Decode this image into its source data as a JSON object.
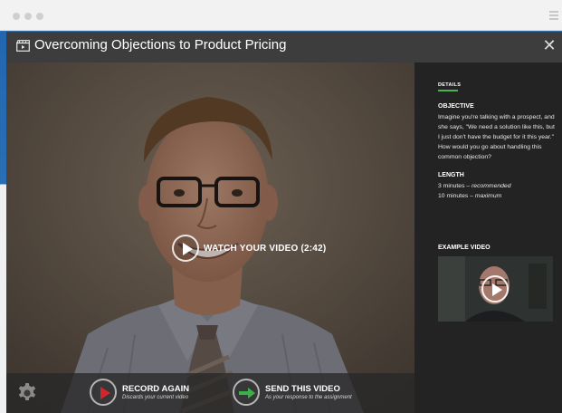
{
  "modal": {
    "title": "Overcoming Objections to Product Pricing"
  },
  "video": {
    "watch_label": "WATCH YOUR VIDEO (2:42)"
  },
  "controls": {
    "record_title": "RECORD AGAIN",
    "record_sub": "Discards your current video",
    "send_title": "SEND THIS VIDEO",
    "send_sub": "As your response to the assignment"
  },
  "details": {
    "tab": "DETAILS",
    "objective_head": "OBJECTIVE",
    "objective_body": "Imagine you're talking with a prospect, and she says, \"We need a solution like this, but I just don't have the budget for it this year.\" How would you go about handling this common objection?",
    "length_head": "LENGTH",
    "length_line1_value": "3 minutes",
    "length_line1_note": "recommended",
    "length_line2_value": "10 minutes",
    "length_line2_note": "maximum",
    "length_separator": " – ",
    "example_head": "EXAMPLE VIDEO"
  },
  "colors": {
    "accent_green": "#4ab24e",
    "record_red": "#d3262c",
    "header_bg": "#3d3d3d",
    "panel_bg": "#232323"
  }
}
